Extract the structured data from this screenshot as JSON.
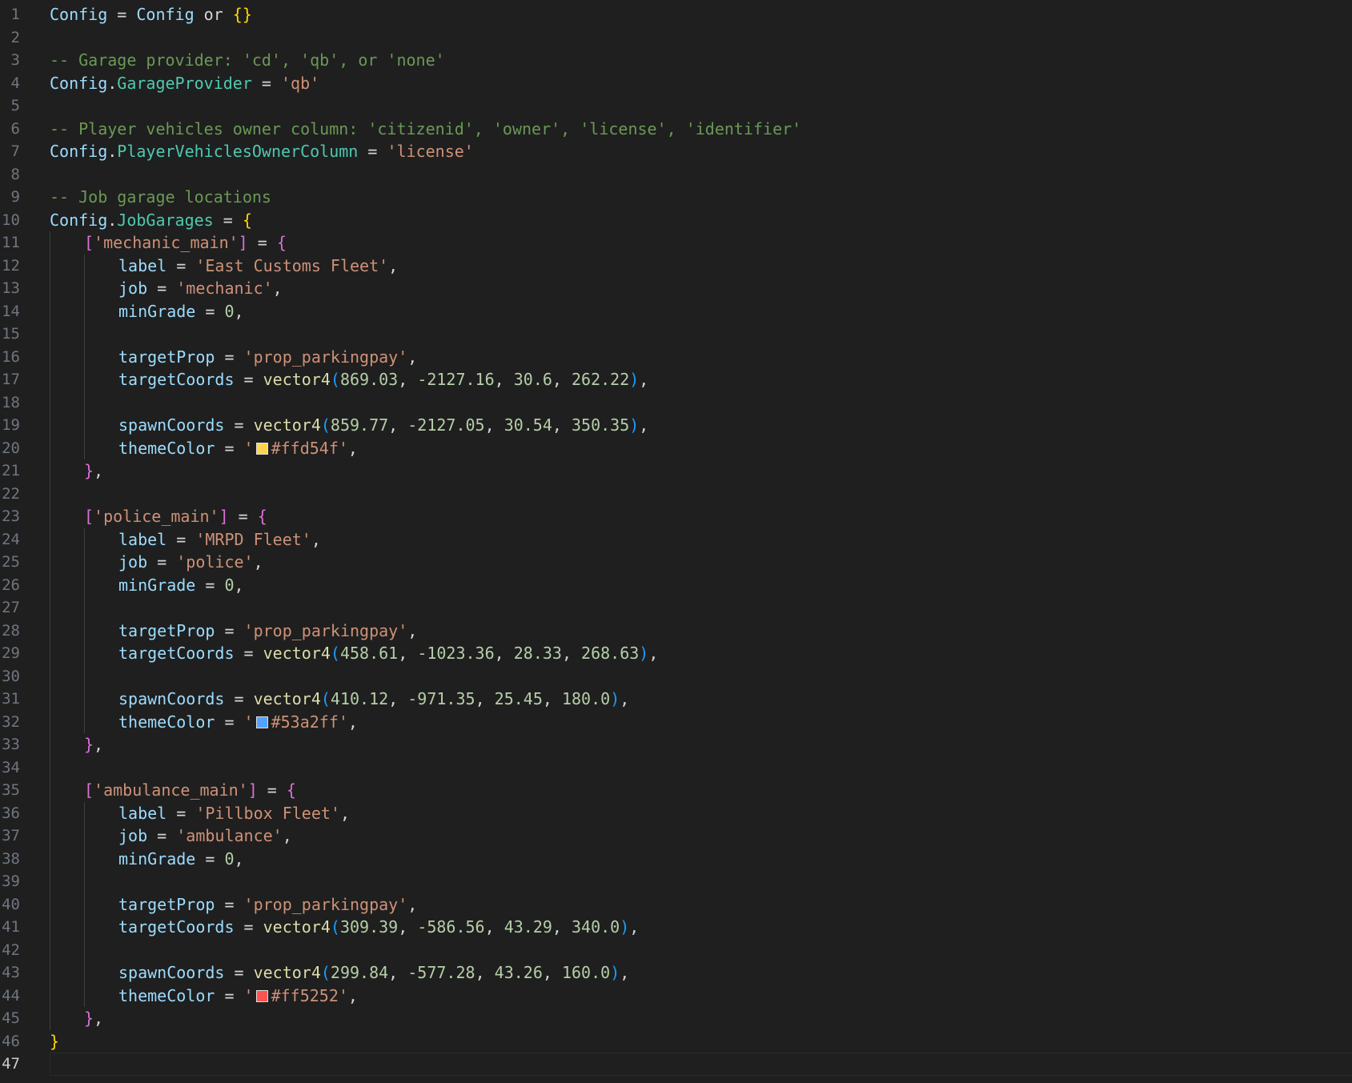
{
  "editor": {
    "indent_guide_color": "#404040",
    "lines": [
      {
        "n": "1",
        "indent": 0,
        "tokens": [
          [
            "var",
            "Config"
          ],
          [
            "op",
            " = "
          ],
          [
            "var",
            "Config"
          ],
          [
            "op",
            " or "
          ],
          [
            "b1",
            "{}"
          ]
        ]
      },
      {
        "n": "2",
        "indent": 0,
        "tokens": []
      },
      {
        "n": "3",
        "indent": 0,
        "tokens": [
          [
            "com",
            "-- Garage provider: 'cd', 'qb', or 'none'"
          ]
        ]
      },
      {
        "n": "4",
        "indent": 0,
        "tokens": [
          [
            "var",
            "Config"
          ],
          [
            "op",
            "."
          ],
          [
            "prop",
            "GarageProvider"
          ],
          [
            "op",
            " = "
          ],
          [
            "str",
            "'qb'"
          ]
        ]
      },
      {
        "n": "5",
        "indent": 0,
        "tokens": []
      },
      {
        "n": "6",
        "indent": 0,
        "tokens": [
          [
            "com",
            "-- Player vehicles owner column: 'citizenid', 'owner', 'license', 'identifier'"
          ]
        ]
      },
      {
        "n": "7",
        "indent": 0,
        "tokens": [
          [
            "var",
            "Config"
          ],
          [
            "op",
            "."
          ],
          [
            "prop",
            "PlayerVehiclesOwnerColumn"
          ],
          [
            "op",
            " = "
          ],
          [
            "str",
            "'license'"
          ]
        ]
      },
      {
        "n": "8",
        "indent": 0,
        "tokens": []
      },
      {
        "n": "9",
        "indent": 0,
        "tokens": [
          [
            "com",
            "-- Job garage locations"
          ]
        ]
      },
      {
        "n": "10",
        "indent": 0,
        "tokens": [
          [
            "var",
            "Config"
          ],
          [
            "op",
            "."
          ],
          [
            "prop",
            "JobGarages"
          ],
          [
            "op",
            " = "
          ],
          [
            "b1",
            "{"
          ]
        ]
      },
      {
        "n": "11",
        "indent": 1,
        "tokens": [
          [
            "b2",
            "["
          ],
          [
            "str",
            "'mechanic_main'"
          ],
          [
            "b2",
            "]"
          ],
          [
            "op",
            " = "
          ],
          [
            "b2",
            "{"
          ]
        ]
      },
      {
        "n": "12",
        "indent": 2,
        "tokens": [
          [
            "var",
            "label"
          ],
          [
            "op",
            " = "
          ],
          [
            "str",
            "'East Customs Fleet'"
          ],
          [
            "op",
            ","
          ]
        ]
      },
      {
        "n": "13",
        "indent": 2,
        "tokens": [
          [
            "var",
            "job"
          ],
          [
            "op",
            " = "
          ],
          [
            "str",
            "'mechanic'"
          ],
          [
            "op",
            ","
          ]
        ]
      },
      {
        "n": "14",
        "indent": 2,
        "tokens": [
          [
            "var",
            "minGrade"
          ],
          [
            "op",
            " = "
          ],
          [
            "num",
            "0"
          ],
          [
            "op",
            ","
          ]
        ]
      },
      {
        "n": "15",
        "indent": 2,
        "tokens": []
      },
      {
        "n": "16",
        "indent": 2,
        "tokens": [
          [
            "var",
            "targetProp"
          ],
          [
            "op",
            " = "
          ],
          [
            "str",
            "'prop_parkingpay'"
          ],
          [
            "op",
            ","
          ]
        ]
      },
      {
        "n": "17",
        "indent": 2,
        "tokens": [
          [
            "var",
            "targetCoords"
          ],
          [
            "op",
            " = "
          ],
          [
            "fn",
            "vector4"
          ],
          [
            "b3",
            "("
          ],
          [
            "num",
            "869.03"
          ],
          [
            "op",
            ", "
          ],
          [
            "num",
            "-2127.16"
          ],
          [
            "op",
            ", "
          ],
          [
            "num",
            "30.6"
          ],
          [
            "op",
            ", "
          ],
          [
            "num",
            "262.22"
          ],
          [
            "b3",
            ")"
          ],
          [
            "op",
            ","
          ]
        ]
      },
      {
        "n": "18",
        "indent": 2,
        "tokens": []
      },
      {
        "n": "19",
        "indent": 2,
        "tokens": [
          [
            "var",
            "spawnCoords"
          ],
          [
            "op",
            " = "
          ],
          [
            "fn",
            "vector4"
          ],
          [
            "b3",
            "("
          ],
          [
            "num",
            "859.77"
          ],
          [
            "op",
            ", "
          ],
          [
            "num",
            "-2127.05"
          ],
          [
            "op",
            ", "
          ],
          [
            "num",
            "30.54"
          ],
          [
            "op",
            ", "
          ],
          [
            "num",
            "350.35"
          ],
          [
            "b3",
            ")"
          ],
          [
            "op",
            ","
          ]
        ]
      },
      {
        "n": "20",
        "indent": 2,
        "tokens": [
          [
            "var",
            "themeColor"
          ],
          [
            "op",
            " = "
          ],
          [
            "str",
            "'"
          ],
          [
            "swatch",
            "#ffd54f"
          ],
          [
            "str",
            "#ffd54f'"
          ],
          [
            "op",
            ","
          ]
        ]
      },
      {
        "n": "21",
        "indent": 1,
        "tokens": [
          [
            "b2",
            "}"
          ],
          [
            "op",
            ","
          ]
        ]
      },
      {
        "n": "22",
        "indent": 1,
        "tokens": []
      },
      {
        "n": "23",
        "indent": 1,
        "tokens": [
          [
            "b2",
            "["
          ],
          [
            "str",
            "'police_main'"
          ],
          [
            "b2",
            "]"
          ],
          [
            "op",
            " = "
          ],
          [
            "b2",
            "{"
          ]
        ]
      },
      {
        "n": "24",
        "indent": 2,
        "tokens": [
          [
            "var",
            "label"
          ],
          [
            "op",
            " = "
          ],
          [
            "str",
            "'MRPD Fleet'"
          ],
          [
            "op",
            ","
          ]
        ]
      },
      {
        "n": "25",
        "indent": 2,
        "tokens": [
          [
            "var",
            "job"
          ],
          [
            "op",
            " = "
          ],
          [
            "str",
            "'police'"
          ],
          [
            "op",
            ","
          ]
        ]
      },
      {
        "n": "26",
        "indent": 2,
        "tokens": [
          [
            "var",
            "minGrade"
          ],
          [
            "op",
            " = "
          ],
          [
            "num",
            "0"
          ],
          [
            "op",
            ","
          ]
        ]
      },
      {
        "n": "27",
        "indent": 2,
        "tokens": []
      },
      {
        "n": "28",
        "indent": 2,
        "tokens": [
          [
            "var",
            "targetProp"
          ],
          [
            "op",
            " = "
          ],
          [
            "str",
            "'prop_parkingpay'"
          ],
          [
            "op",
            ","
          ]
        ]
      },
      {
        "n": "29",
        "indent": 2,
        "tokens": [
          [
            "var",
            "targetCoords"
          ],
          [
            "op",
            " = "
          ],
          [
            "fn",
            "vector4"
          ],
          [
            "b3",
            "("
          ],
          [
            "num",
            "458.61"
          ],
          [
            "op",
            ", "
          ],
          [
            "num",
            "-1023.36"
          ],
          [
            "op",
            ", "
          ],
          [
            "num",
            "28.33"
          ],
          [
            "op",
            ", "
          ],
          [
            "num",
            "268.63"
          ],
          [
            "b3",
            ")"
          ],
          [
            "op",
            ","
          ]
        ]
      },
      {
        "n": "30",
        "indent": 2,
        "tokens": []
      },
      {
        "n": "31",
        "indent": 2,
        "tokens": [
          [
            "var",
            "spawnCoords"
          ],
          [
            "op",
            " = "
          ],
          [
            "fn",
            "vector4"
          ],
          [
            "b3",
            "("
          ],
          [
            "num",
            "410.12"
          ],
          [
            "op",
            ", "
          ],
          [
            "num",
            "-971.35"
          ],
          [
            "op",
            ", "
          ],
          [
            "num",
            "25.45"
          ],
          [
            "op",
            ", "
          ],
          [
            "num",
            "180.0"
          ],
          [
            "b3",
            ")"
          ],
          [
            "op",
            ","
          ]
        ]
      },
      {
        "n": "32",
        "indent": 2,
        "tokens": [
          [
            "var",
            "themeColor"
          ],
          [
            "op",
            " = "
          ],
          [
            "str",
            "'"
          ],
          [
            "swatch",
            "#53a2ff"
          ],
          [
            "str",
            "#53a2ff'"
          ],
          [
            "op",
            ","
          ]
        ]
      },
      {
        "n": "33",
        "indent": 1,
        "tokens": [
          [
            "b2",
            "}"
          ],
          [
            "op",
            ","
          ]
        ]
      },
      {
        "n": "34",
        "indent": 1,
        "tokens": []
      },
      {
        "n": "35",
        "indent": 1,
        "tokens": [
          [
            "b2",
            "["
          ],
          [
            "str",
            "'ambulance_main'"
          ],
          [
            "b2",
            "]"
          ],
          [
            "op",
            " = "
          ],
          [
            "b2",
            "{"
          ]
        ]
      },
      {
        "n": "36",
        "indent": 2,
        "tokens": [
          [
            "var",
            "label"
          ],
          [
            "op",
            " = "
          ],
          [
            "str",
            "'Pillbox Fleet'"
          ],
          [
            "op",
            ","
          ]
        ]
      },
      {
        "n": "37",
        "indent": 2,
        "tokens": [
          [
            "var",
            "job"
          ],
          [
            "op",
            " = "
          ],
          [
            "str",
            "'ambulance'"
          ],
          [
            "op",
            ","
          ]
        ]
      },
      {
        "n": "38",
        "indent": 2,
        "tokens": [
          [
            "var",
            "minGrade"
          ],
          [
            "op",
            " = "
          ],
          [
            "num",
            "0"
          ],
          [
            "op",
            ","
          ]
        ]
      },
      {
        "n": "39",
        "indent": 2,
        "tokens": []
      },
      {
        "n": "40",
        "indent": 2,
        "tokens": [
          [
            "var",
            "targetProp"
          ],
          [
            "op",
            " = "
          ],
          [
            "str",
            "'prop_parkingpay'"
          ],
          [
            "op",
            ","
          ]
        ]
      },
      {
        "n": "41",
        "indent": 2,
        "tokens": [
          [
            "var",
            "targetCoords"
          ],
          [
            "op",
            " = "
          ],
          [
            "fn",
            "vector4"
          ],
          [
            "b3",
            "("
          ],
          [
            "num",
            "309.39"
          ],
          [
            "op",
            ", "
          ],
          [
            "num",
            "-586.56"
          ],
          [
            "op",
            ", "
          ],
          [
            "num",
            "43.29"
          ],
          [
            "op",
            ", "
          ],
          [
            "num",
            "340.0"
          ],
          [
            "b3",
            ")"
          ],
          [
            "op",
            ","
          ]
        ]
      },
      {
        "n": "42",
        "indent": 2,
        "tokens": []
      },
      {
        "n": "43",
        "indent": 2,
        "tokens": [
          [
            "var",
            "spawnCoords"
          ],
          [
            "op",
            " = "
          ],
          [
            "fn",
            "vector4"
          ],
          [
            "b3",
            "("
          ],
          [
            "num",
            "299.84"
          ],
          [
            "op",
            ", "
          ],
          [
            "num",
            "-577.28"
          ],
          [
            "op",
            ", "
          ],
          [
            "num",
            "43.26"
          ],
          [
            "op",
            ", "
          ],
          [
            "num",
            "160.0"
          ],
          [
            "b3",
            ")"
          ],
          [
            "op",
            ","
          ]
        ]
      },
      {
        "n": "44",
        "indent": 2,
        "tokens": [
          [
            "var",
            "themeColor"
          ],
          [
            "op",
            " = "
          ],
          [
            "str",
            "'"
          ],
          [
            "swatch",
            "#ff5252"
          ],
          [
            "str",
            "#ff5252'"
          ],
          [
            "op",
            ","
          ]
        ]
      },
      {
        "n": "45",
        "indent": 1,
        "tokens": [
          [
            "b2",
            "}"
          ],
          [
            "op",
            ","
          ]
        ]
      },
      {
        "n": "46",
        "indent": 0,
        "tokens": [
          [
            "b1",
            "}"
          ]
        ]
      },
      {
        "n": "47",
        "indent": 0,
        "tokens": [],
        "current": true
      }
    ]
  }
}
